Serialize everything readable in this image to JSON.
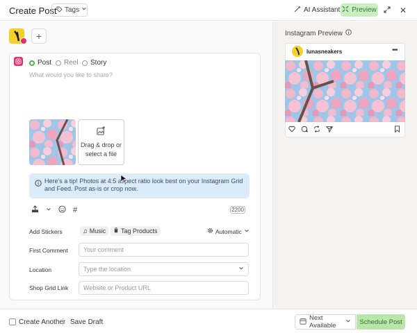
{
  "header": {
    "title": "Create Post",
    "tags_label": "Tags",
    "ai_label": "AI Assistant",
    "preview_label": "Preview"
  },
  "composer": {
    "post_types": [
      "Post",
      "Reel",
      "Story"
    ],
    "selected_type": "Post",
    "caption_placeholder": "What would you like to share?",
    "dropzone_text": [
      "Drag & drop or",
      "select a file"
    ],
    "tip_text": "Here's a tip! Photos at 4:5 aspect ratio look best on your Instagram Grid and Feed. Post as-is or crop now.",
    "char_count": "2200"
  },
  "fields": {
    "stickers_label": "Add Stickers",
    "music_label": "Music",
    "tag_products_label": "Tag Products",
    "automatic_label": "Automatic",
    "first_comment_label": "First Comment",
    "first_comment_placeholder": "Your comment",
    "location_label": "Location",
    "location_placeholder": "Type the location",
    "shop_link_label": "Shop Grid Link",
    "shop_link_placeholder": "Website or Product URL"
  },
  "preview": {
    "title": "Instagram Preview",
    "username": "lunasneakers"
  },
  "footer": {
    "create_another": "Create Another",
    "save_draft": "Save Draft",
    "next_available": "Next Available",
    "schedule": "Schedule Post"
  },
  "colors": {
    "accent_green": "#c9efc0",
    "instagram_pink": "#e1306c",
    "tip_blue": "#dcebf8"
  }
}
